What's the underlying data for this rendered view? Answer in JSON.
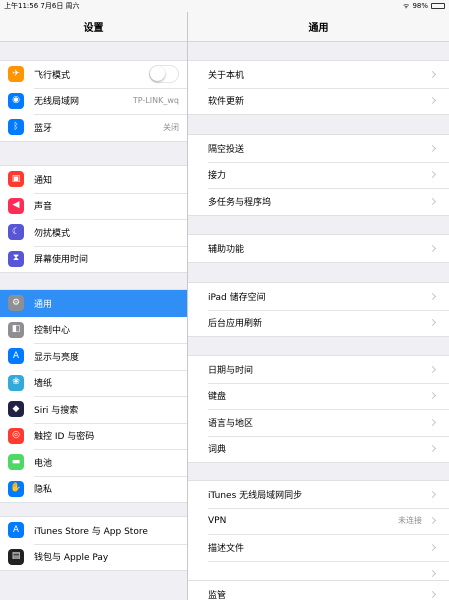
{
  "status": {
    "time": "上午11:56",
    "date": "7月6日 周六",
    "battery": "98%",
    "battery_level": 0.98
  },
  "master": {
    "title": "设置",
    "groups": [
      [
        {
          "label": "飞行模式",
          "icon": "airplane-icon",
          "color": "#ff9500",
          "glyph": "✈",
          "toggle": false
        },
        {
          "label": "无线局域网",
          "value": "TP-LINK_wq",
          "icon": "wifi-icon",
          "color": "#007aff",
          "glyph": "◉"
        },
        {
          "label": "蓝牙",
          "value": "关闭",
          "icon": "bluetooth-icon",
          "color": "#007aff",
          "glyph": "ᛒ"
        }
      ],
      [
        {
          "label": "通知",
          "icon": "notification-icon",
          "color": "#ff3b30",
          "glyph": "▣"
        },
        {
          "label": "声音",
          "icon": "sound-icon",
          "color": "#ff2d55",
          "glyph": "◀"
        },
        {
          "label": "勿扰模式",
          "icon": "moon-icon",
          "color": "#5856d6",
          "glyph": "☾"
        },
        {
          "label": "屏幕使用时间",
          "icon": "hourglass-icon",
          "color": "#5856d6",
          "glyph": "⧗"
        }
      ],
      [
        {
          "label": "通用",
          "icon": "gear-icon",
          "color": "#8e8e93",
          "glyph": "⚙",
          "selected": true
        },
        {
          "label": "控制中心",
          "icon": "control-center-icon",
          "color": "#8e8e93",
          "glyph": "◧"
        },
        {
          "label": "显示与亮度",
          "icon": "display-icon",
          "color": "#007aff",
          "glyph": "A"
        },
        {
          "label": "墙纸",
          "icon": "wallpaper-icon",
          "color": "#34aadc",
          "glyph": "❀"
        },
        {
          "label": "Siri 与搜索",
          "icon": "siri-icon",
          "color": "#222244",
          "glyph": "◆"
        },
        {
          "label": "触控 ID 与密码",
          "icon": "fingerprint-icon",
          "color": "#ff3b30",
          "glyph": "◎"
        },
        {
          "label": "电池",
          "icon": "battery-icon",
          "color": "#4cd964",
          "glyph": "▬"
        },
        {
          "label": "隐私",
          "icon": "hand-icon",
          "color": "#007aff",
          "glyph": "✋"
        }
      ],
      [
        {
          "label": "iTunes Store 与 App Store",
          "icon": "appstore-icon",
          "color": "#007aff",
          "glyph": "A"
        },
        {
          "label": "钱包与 Apple Pay",
          "icon": "wallet-icon",
          "color": "#222222",
          "glyph": "▤"
        }
      ]
    ]
  },
  "detail": {
    "title": "通用",
    "groups": [
      [
        {
          "label": "关于本机"
        },
        {
          "label": "软件更新"
        }
      ],
      [
        {
          "label": "隔空投送"
        },
        {
          "label": "接力"
        },
        {
          "label": "多任务与程序坞"
        }
      ],
      [
        {
          "label": "辅助功能"
        }
      ],
      [
        {
          "label": "iPad 储存空间"
        },
        {
          "label": "后台应用刷新"
        }
      ],
      [
        {
          "label": "日期与时间"
        },
        {
          "label": "键盘"
        },
        {
          "label": "语言与地区"
        },
        {
          "label": "词典"
        }
      ],
      [
        {
          "label": "iTunes 无线局域网同步"
        },
        {
          "label": "VPN",
          "value": "未连接"
        },
        {
          "label": "描述文件"
        },
        {
          "label": ""
        }
      ],
      [
        {
          "label": "监管"
        }
      ]
    ]
  }
}
